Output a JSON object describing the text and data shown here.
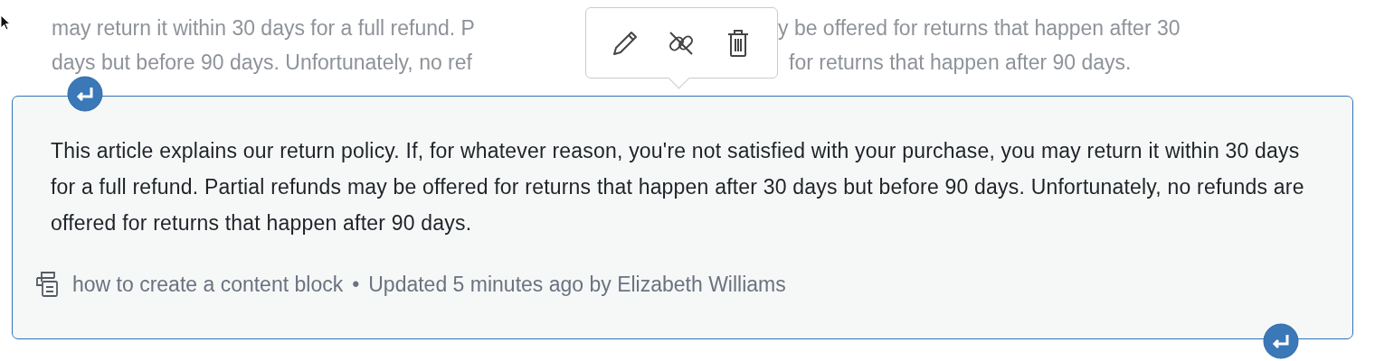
{
  "background_text": {
    "lines": [
      {
        "before": "may return it within 30 days for a full refund. P",
        "after": "y be offered for returns that happen after 30"
      },
      {
        "before": "days but before 90 days. Unfortunately, no ref",
        "after": "for returns that happen after 90 days."
      }
    ]
  },
  "toolbar": {
    "buttons": [
      {
        "kind": "edit"
      },
      {
        "kind": "unlink"
      },
      {
        "kind": "delete"
      }
    ]
  },
  "block": {
    "selected": true,
    "body": "This article explains our return policy. If, for whatever reason, you're not satisfied with your purchase, you may return it within 30 days for a full refund. Partial refunds may be offered for returns that happen after 30 days but before 90 days. Unfortunately, no refunds are offered for returns that happen after 90 days.",
    "source": "how to create a content block",
    "separator": "•",
    "meta": "Updated 5 minutes ago by Elizabeth Williams"
  }
}
